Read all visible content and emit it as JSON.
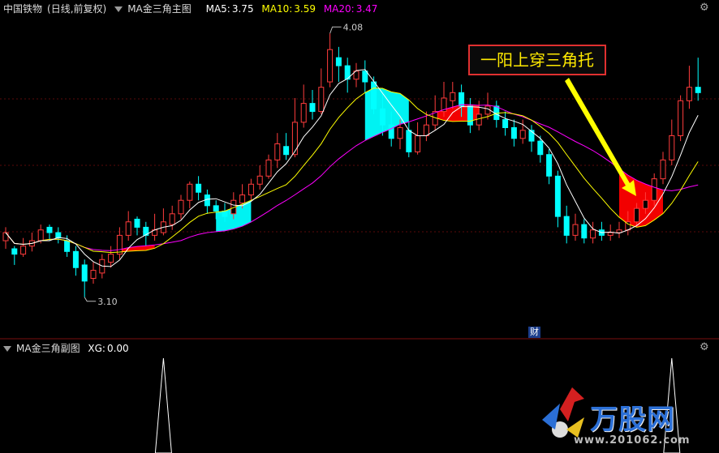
{
  "header_main": {
    "stock": "中国铁物",
    "period": "(日线,前复权)",
    "indicator": "MA金三角主图",
    "ma5_label": "MA5:",
    "ma5_value": "3.75",
    "ma10_label": "MA10:",
    "ma10_value": "3.59",
    "ma20_label": "MA20:",
    "ma20_value": "3.47"
  },
  "header_sub": {
    "indicator": "MA金三角副图",
    "xg_label": "XG:",
    "xg_value": "0.00"
  },
  "annotation": "一阳上穿三角托",
  "cai_badge": "财",
  "logo": {
    "text": "万股网",
    "url": "www.201062.com"
  },
  "colors": {
    "bull": "#ff3c3c",
    "bear": "#00ffff",
    "ma5": "#ffffff",
    "ma10": "#ffff00",
    "ma20": "#ff00ff",
    "up_triangle": "#ff0000",
    "down_triangle": "#00ffff",
    "annotation_border": "#e03030",
    "annotation_text": "#ffea00",
    "arrow": "#ffff00"
  },
  "chart_data": {
    "type": "candlestick",
    "y_range": [
      3.0,
      4.15
    ],
    "max_label": "4.08",
    "min_label": "3.10",
    "candles": [
      [
        3.31,
        3.34,
        3.36,
        3.28
      ],
      [
        3.28,
        3.26,
        3.29,
        3.22
      ],
      [
        3.26,
        3.29,
        3.32,
        3.25
      ],
      [
        3.29,
        3.31,
        3.34,
        3.27
      ],
      [
        3.31,
        3.35,
        3.37,
        3.3
      ],
      [
        3.36,
        3.34,
        3.37,
        3.31
      ],
      [
        3.34,
        3.32,
        3.36,
        3.3
      ],
      [
        3.31,
        3.27,
        3.33,
        3.25
      ],
      [
        3.27,
        3.21,
        3.29,
        3.18
      ],
      [
        3.22,
        3.16,
        3.24,
        3.1
      ],
      [
        3.17,
        3.2,
        3.23,
        3.15
      ],
      [
        3.19,
        3.24,
        3.26,
        3.17
      ],
      [
        3.23,
        3.26,
        3.29,
        3.21
      ],
      [
        3.26,
        3.33,
        3.36,
        3.24
      ],
      [
        3.33,
        3.38,
        3.42,
        3.31
      ],
      [
        3.39,
        3.36,
        3.4,
        3.33
      ],
      [
        3.36,
        3.33,
        3.38,
        3.29
      ],
      [
        3.33,
        3.35,
        3.41,
        3.31
      ],
      [
        3.34,
        3.38,
        3.43,
        3.33
      ],
      [
        3.37,
        3.41,
        3.44,
        3.35
      ],
      [
        3.41,
        3.46,
        3.48,
        3.39
      ],
      [
        3.46,
        3.52,
        3.53,
        3.43
      ],
      [
        3.52,
        3.49,
        3.55,
        3.46
      ],
      [
        3.48,
        3.44,
        3.5,
        3.41
      ],
      [
        3.44,
        3.42,
        3.46,
        3.39
      ],
      [
        3.42,
        3.4,
        3.45,
        3.38
      ],
      [
        3.41,
        3.46,
        3.49,
        3.39
      ],
      [
        3.45,
        3.48,
        3.52,
        3.43
      ],
      [
        3.48,
        3.52,
        3.54,
        3.46
      ],
      [
        3.52,
        3.55,
        3.59,
        3.5
      ],
      [
        3.55,
        3.61,
        3.63,
        3.54
      ],
      [
        3.61,
        3.67,
        3.71,
        3.58
      ],
      [
        3.66,
        3.63,
        3.71,
        3.61
      ],
      [
        3.63,
        3.75,
        3.84,
        3.62
      ],
      [
        3.75,
        3.82,
        3.89,
        3.73
      ],
      [
        3.82,
        3.79,
        3.87,
        3.76
      ],
      [
        3.79,
        3.88,
        3.95,
        3.78
      ],
      [
        3.9,
        4.02,
        4.08,
        3.88
      ],
      [
        3.99,
        3.96,
        4.03,
        3.9
      ],
      [
        3.96,
        3.91,
        3.99,
        3.86
      ],
      [
        3.91,
        3.94,
        3.97,
        3.88
      ],
      [
        3.94,
        3.9,
        3.98,
        3.86
      ],
      [
        3.9,
        3.8,
        3.92,
        3.78
      ],
      [
        3.8,
        3.74,
        3.86,
        3.7
      ],
      [
        3.74,
        3.69,
        3.79,
        3.66
      ],
      [
        3.69,
        3.73,
        3.76,
        3.65
      ],
      [
        3.72,
        3.64,
        3.75,
        3.62
      ],
      [
        3.64,
        3.7,
        3.75,
        3.63
      ],
      [
        3.7,
        3.74,
        3.79,
        3.68
      ],
      [
        3.74,
        3.79,
        3.85,
        3.72
      ],
      [
        3.79,
        3.84,
        3.9,
        3.77
      ],
      [
        3.83,
        3.86,
        3.9,
        3.8
      ],
      [
        3.86,
        3.81,
        3.89,
        3.77
      ],
      [
        3.81,
        3.74,
        3.84,
        3.71
      ],
      [
        3.74,
        3.78,
        3.83,
        3.72
      ],
      [
        3.78,
        3.81,
        3.86,
        3.76
      ],
      [
        3.81,
        3.76,
        3.83,
        3.73
      ],
      [
        3.76,
        3.73,
        3.79,
        3.7
      ],
      [
        3.73,
        3.69,
        3.76,
        3.66
      ],
      [
        3.69,
        3.72,
        3.76,
        3.67
      ],
      [
        3.72,
        3.68,
        3.74,
        3.64
      ],
      [
        3.68,
        3.63,
        3.7,
        3.6
      ],
      [
        3.63,
        3.55,
        3.65,
        3.52
      ],
      [
        3.55,
        3.4,
        3.57,
        3.36
      ],
      [
        3.4,
        3.33,
        3.44,
        3.3
      ],
      [
        3.33,
        3.37,
        3.41,
        3.31
      ],
      [
        3.37,
        3.32,
        3.39,
        3.3
      ],
      [
        3.32,
        3.35,
        3.38,
        3.3
      ],
      [
        3.35,
        3.33,
        3.38,
        3.31
      ],
      [
        3.33,
        3.34,
        3.37,
        3.31
      ],
      [
        3.34,
        3.35,
        3.38,
        3.32
      ],
      [
        3.35,
        3.38,
        3.42,
        3.33
      ],
      [
        3.38,
        3.43,
        3.45,
        3.36
      ],
      [
        3.43,
        3.46,
        3.49,
        3.41
      ],
      [
        3.46,
        3.54,
        3.56,
        3.44
      ],
      [
        3.54,
        3.61,
        3.64,
        3.52
      ],
      [
        3.61,
        3.7,
        3.76,
        3.59
      ],
      [
        3.7,
        3.83,
        3.85,
        3.68
      ],
      [
        3.83,
        3.88,
        3.96,
        3.8
      ],
      [
        3.88,
        3.86,
        3.99,
        3.83
      ]
    ],
    "xg_signal_indices": [
      18,
      76
    ]
  }
}
